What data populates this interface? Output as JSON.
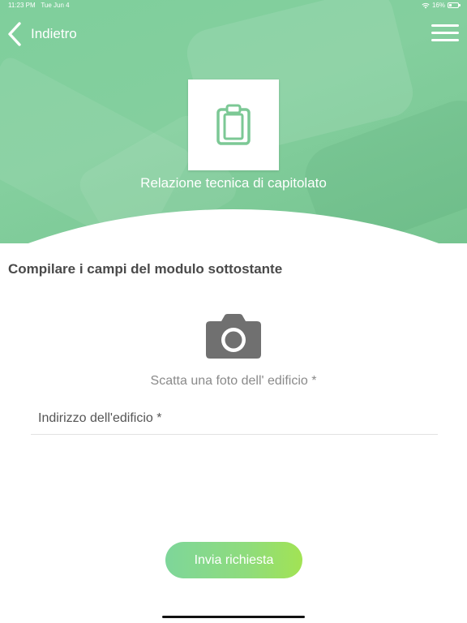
{
  "status_bar": {
    "time": "11:23 PM",
    "date": "Tue Jun 4",
    "battery": "16%"
  },
  "nav": {
    "back_label": "Indietro"
  },
  "document": {
    "title": "Relazione tecnica di capitolato",
    "icon": "clipboard-icon"
  },
  "form": {
    "instructions": "Compilare i campi del modulo sottostante",
    "photo_label": "Scatta una foto dell' edificio *",
    "address_placeholder": "Indirizzo dell'edificio *",
    "address_value": "",
    "submit_label": "Invia richiesta"
  },
  "colors": {
    "header_green": "#7fcf9c",
    "icon_green": "#7cc895",
    "camera_gray": "#707070",
    "button_gradient_start": "#7ed69a",
    "button_gradient_end": "#a2e354"
  }
}
